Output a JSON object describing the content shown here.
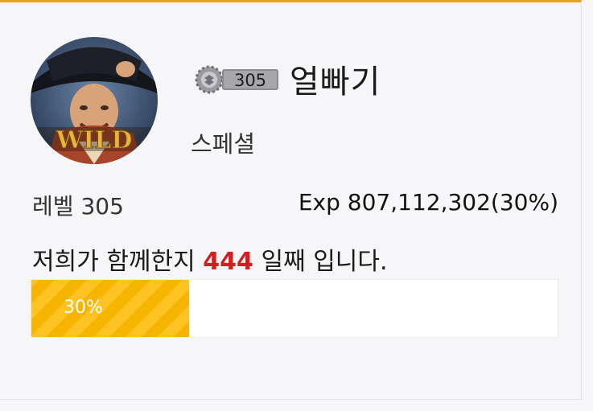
{
  "profile": {
    "nickname": "얼빠기",
    "grade": "스페셜",
    "badge_level": "305",
    "avatar_text": "WILD"
  },
  "stats": {
    "level_label": "레벨",
    "level_value": "305",
    "exp_text": "Exp 807,112,302(30%)"
  },
  "membership": {
    "prefix": "저희가 함께한지",
    "days": "444",
    "suffix": "일째 입니다."
  },
  "progress": {
    "percent": 30,
    "label": "30%"
  },
  "colors": {
    "accent": "#f0a020",
    "progress_fill": "#f7b400",
    "days_highlight": "#d61c1c"
  },
  "icons": {
    "badge": "level-badge-icon",
    "avatar": "user-avatar"
  }
}
